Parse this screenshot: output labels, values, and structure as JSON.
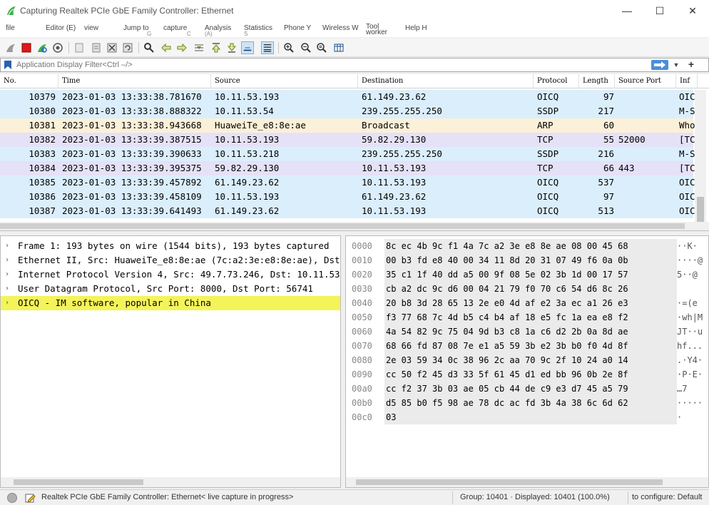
{
  "window": {
    "title": "Capturing Realtek PCIe GbE Family Controller: Ethernet",
    "minimize": "—",
    "maximize": "☐",
    "close": "✕"
  },
  "menu": {
    "items": [
      {
        "label": "file",
        "sub": ""
      },
      {
        "label": "Editor (E)",
        "sub": ""
      },
      {
        "label": "view",
        "sub": ""
      },
      {
        "label": "Jump to",
        "sub": "G"
      },
      {
        "label": "capture",
        "sub": "C"
      },
      {
        "label": "Analysis",
        "sub": "(A)"
      },
      {
        "label": "Statistics",
        "sub": "S"
      },
      {
        "label": "Phone Y",
        "sub": ""
      },
      {
        "label": "Wireless W",
        "sub": ""
      },
      {
        "label": "Tool worker",
        "sub": ""
      },
      {
        "label": "Help H",
        "sub": ""
      }
    ]
  },
  "filter": {
    "placeholder": "Application Display Filter<Ctrl –/>",
    "plus": "+"
  },
  "packet_list": {
    "columns": [
      "No.",
      "Time",
      "Source",
      "Destination",
      "Protocol",
      "Length",
      "Source Port",
      "Inf"
    ],
    "rows": [
      {
        "no": "10379",
        "time": "2023-01-03 13:33:38.781670",
        "src": "10.11.53.193",
        "dst": "61.149.23.62",
        "proto": "OICQ",
        "len": "97",
        "sport": "",
        "info": "OIC",
        "color": "#dbeefc"
      },
      {
        "no": "10380",
        "time": "2023-01-03 13:33:38.888322",
        "src": "10.11.53.54",
        "dst": "239.255.255.250",
        "proto": "SSDP",
        "len": "217",
        "sport": "",
        "info": "M-S",
        "color": "#dbeefc"
      },
      {
        "no": "10381",
        "time": "2023-01-03 13:33:38.943668",
        "src": "HuaweiTe_e8:8e:ae",
        "dst": "Broadcast",
        "proto": "ARP",
        "len": "60",
        "sport": "",
        "info": "Who",
        "color": "#fbf0d8"
      },
      {
        "no": "10382",
        "time": "2023-01-03 13:33:39.387515",
        "src": "10.11.53.193",
        "dst": "59.82.29.130",
        "proto": "TCP",
        "len": "55",
        "sport": "52000",
        "info": "[TC",
        "color": "#e5e1f7"
      },
      {
        "no": "10383",
        "time": "2023-01-03 13:33:39.390633",
        "src": "10.11.53.218",
        "dst": "239.255.255.250",
        "proto": "SSDP",
        "len": "216",
        "sport": "",
        "info": "M-S",
        "color": "#dbeefc"
      },
      {
        "no": "10384",
        "time": "2023-01-03 13:33:39.395375",
        "src": "59.82.29.130",
        "dst": "10.11.53.193",
        "proto": "TCP",
        "len": "66",
        "sport": "443",
        "info": "[TC",
        "color": "#e5e1f7"
      },
      {
        "no": "10385",
        "time": "2023-01-03 13:33:39.457892",
        "src": "61.149.23.62",
        "dst": "10.11.53.193",
        "proto": "OICQ",
        "len": "537",
        "sport": "",
        "info": "OIC",
        "color": "#dbeefc"
      },
      {
        "no": "10386",
        "time": "2023-01-03 13:33:39.458109",
        "src": "10.11.53.193",
        "dst": "61.149.23.62",
        "proto": "OICQ",
        "len": "97",
        "sport": "",
        "info": "OIC",
        "color": "#dbeefc"
      },
      {
        "no": "10387",
        "time": "2023-01-03 13:33:39.641493",
        "src": "61.149.23.62",
        "dst": "10.11.53.193",
        "proto": "OICQ",
        "len": "513",
        "sport": "",
        "info": "OIC",
        "color": "#dbeefc"
      }
    ]
  },
  "details": {
    "rows": [
      {
        "arrow": "›",
        "text": "Frame 1: 193 bytes on wire (1544 bits), 193 bytes captured",
        "highlight": false
      },
      {
        "arrow": "›",
        "text": "Ethernet II, Src: HuaweiTe_e8:8e:ae (7c:a2:3e:e8:8e:ae), Dst:",
        "highlight": false
      },
      {
        "arrow": "›",
        "text": "Internet Protocol Version 4, Src: 49.7.73.246, Dst: 10.11.53",
        "highlight": false
      },
      {
        "arrow": "›",
        "text": "User Datagram Protocol, Src Port: 8000, Dst Port: 56741",
        "highlight": false
      },
      {
        "arrow": "›",
        "text": "OICQ - IM software, popular in China",
        "highlight": true
      }
    ]
  },
  "bytes": {
    "rows": [
      {
        "off": "0000",
        "hex": "8c ec 4b 9c f1 4a 7c a2  3e e8 8e ae 08 00 45 68",
        "ascii": "··K·"
      },
      {
        "off": "0010",
        "hex": "00 b3 fd e8 40 00 34 11  8d 20 31 07 49 f6 0a 0b",
        "ascii": "····@"
      },
      {
        "off": "0020",
        "hex": "35 c1 1f 40 dd a5 00 9f  08 5e 02 3b 1d 00 17 57",
        "ascii": "5··@"
      },
      {
        "off": "0030",
        "hex": "cb a2 dc 9c d6 00 04 21  79 f0 70 c6 54 d6 8c 26",
        "ascii": ""
      },
      {
        "off": "0040",
        "hex": "20 b8 3d 28 65 13 2e e0  4d af e2 3a ec a1 26 e3",
        "ascii": "·=(e"
      },
      {
        "off": "0050",
        "hex": "f3 77 68 7c 4d b5 c4 b4  af 18 e5 fc 1a ea e8 f2",
        "ascii": "·wh|M"
      },
      {
        "off": "0060",
        "hex": "4a 54 82 9c 75 04 9d b3  c8 1a c6 d2 2b 0a 8d ae",
        "ascii": "JT··u"
      },
      {
        "off": "0070",
        "hex": "68 66 fd 87 08 7e e1 a5  59 3b e2 3b b0 f0 4d 8f",
        "ascii": "hf..."
      },
      {
        "off": "0080",
        "hex": "2e 03 59 34 0c 38 96 2c  aa 70 9c 2f 10 24 a0 14",
        "ascii": ".·Y4·"
      },
      {
        "off": "0090",
        "hex": "cc 50 f2 45 d3 33 5f 61  45 d1 ed bb 96 0b 2e 8f",
        "ascii": "·P·E·"
      },
      {
        "off": "00a0",
        "hex": "cc f2 37 3b 03 ae 05 cb  44 de c9 e3 d7 45 a5 79",
        "ascii": "…7"
      },
      {
        "off": "00b0",
        "hex": "d5 85 b0 f5 98 ae 78 dc  ac fd 3b 4a 38 6c 6d 62",
        "ascii": "·····"
      },
      {
        "off": "00c0",
        "hex": "03",
        "ascii": "·"
      }
    ]
  },
  "status": {
    "interface": "Realtek PCIe GbE Family Controller: Ethernet< live capture in progress>",
    "group": "Group: 10401 · Displayed: 10401 (100.0%)",
    "profile": "to configure: Default"
  },
  "colors": {
    "udp_row": "#dbeefc",
    "arp_row": "#fbf0d8",
    "tcp_row": "#e5e1f7",
    "highlight": "#f4f45a"
  }
}
